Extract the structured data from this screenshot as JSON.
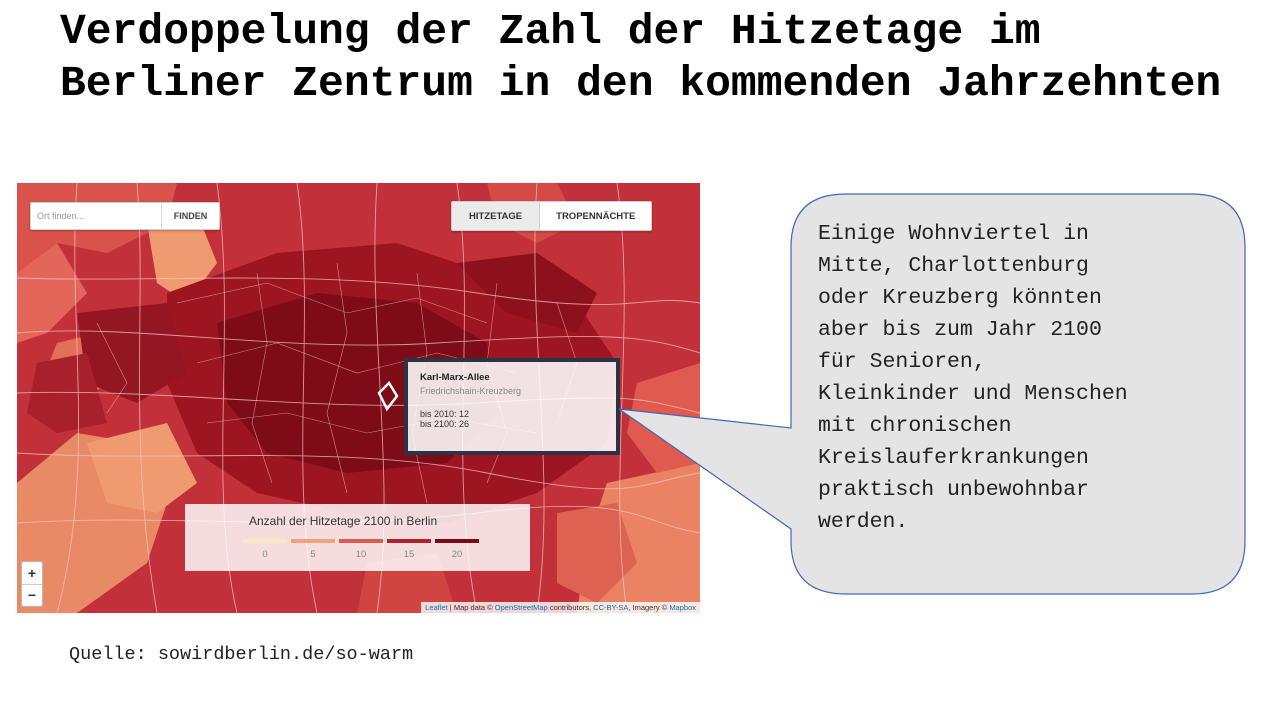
{
  "slide": {
    "title": "Verdoppelung der Zahl der Hitzetage im Berliner Zentrum in den kommenden Jahrzehnten",
    "source": "Quelle: sowirdberlin.de/so-warm"
  },
  "map": {
    "search": {
      "placeholder": "Ort finden...",
      "button": "FINDEN"
    },
    "tabs": [
      {
        "label": "HITZETAGE",
        "active": true
      },
      {
        "label": "TROPENNÄCHTE",
        "active": false
      }
    ],
    "tooltip": {
      "name": "Karl-Marx-Allee",
      "district": "Friedrichshain-Kreuzberg",
      "line_2010": "bis 2010: 12",
      "line_2100": "bis 2100: 26"
    },
    "legend": {
      "title": "Anzahl der Hitzetage 2100 in Berlin",
      "ticks": [
        "0",
        "5",
        "10",
        "15",
        "20"
      ],
      "colors": [
        "#fbe8c0",
        "#f2a27a",
        "#de5a4f",
        "#b5202c",
        "#7a0b15"
      ]
    },
    "zoom": {
      "in": "+",
      "out": "−"
    },
    "attribution": {
      "leaflet": "Leaflet",
      "map_data": " | Map data © ",
      "osm": "OpenStreetMap",
      "contributors": " contributors, ",
      "license": "CC-BY-SA",
      "imagery": ", Imagery © ",
      "mapbox": "Mapbox"
    }
  },
  "callout": {
    "text": "Einige Wohnviertel in\nMitte, Charlottenburg\noder Kreuzberg könnten\naber bis zum Jahr 2100\nfür Senioren,\nKleinkinder und Menschen\nmit chronischen\nKreislauferkrankungen\npraktisch unbewohnbar\nwerden."
  }
}
